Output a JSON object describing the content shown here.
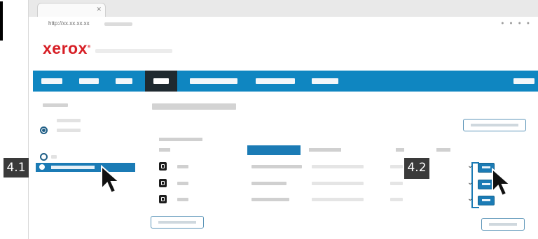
{
  "callouts": {
    "step_a": "4.1",
    "step_b": "4.2"
  },
  "browser": {
    "url": "http://xx.xx.xx.xx"
  },
  "header": {
    "logo": "xerox"
  },
  "colors": {
    "nav_blue": "#0f86c1",
    "nav_active": "#1f2a30",
    "selected_blue": "#1b7bb5",
    "logo_red": "#d71f26",
    "callout_bg": "#3a3a3a"
  },
  "icons": [
    "cursor-arrow-icon",
    "device-icon",
    "chevron-down-icon",
    "radio-icon",
    "close-icon"
  ],
  "table": {
    "rows": 3
  }
}
